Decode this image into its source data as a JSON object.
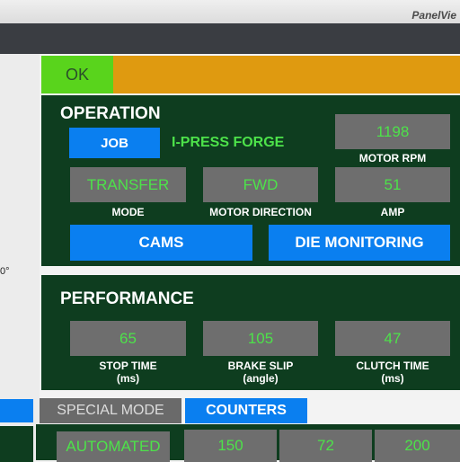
{
  "brand": "PanelVie",
  "left_readout": "0°",
  "status": {
    "ok_label": "OK"
  },
  "operation": {
    "title": "OPERATION",
    "job_button": "JOB",
    "job_name": "I-PRESS FORGE",
    "motor_rpm": {
      "value": "1198",
      "label": "MOTOR RPM"
    },
    "mode": {
      "value": "TRANSFER",
      "label": "MODE"
    },
    "motor_direction": {
      "value": "FWD",
      "label": "MOTOR DIRECTION"
    },
    "amp": {
      "value": "51",
      "label": "AMP"
    },
    "cams_button": "CAMS",
    "die_monitoring_button": "DIE MONITORING"
  },
  "performance": {
    "title": "PERFORMANCE",
    "stop_time": {
      "value": "65",
      "label": "STOP TIME",
      "unit": "(ms)"
    },
    "brake_slip": {
      "value": "105",
      "label": "BRAKE SLIP",
      "unit": "(angle)"
    },
    "clutch_time": {
      "value": "47",
      "label": "CLUTCH TIME",
      "unit": "(ms)"
    }
  },
  "tabs": {
    "special_mode": "SPECIAL MODE",
    "counters": "COUNTERS"
  },
  "bottom": {
    "mode_value": "AUTOMATED",
    "counters": [
      "150",
      "72",
      "200"
    ]
  },
  "colors": {
    "panel": "#0e3d1f",
    "button_blue": "#0a7ff0",
    "value_green": "#4de24a",
    "ok_green": "#59d41c",
    "alarm_orange": "#df9a10"
  }
}
